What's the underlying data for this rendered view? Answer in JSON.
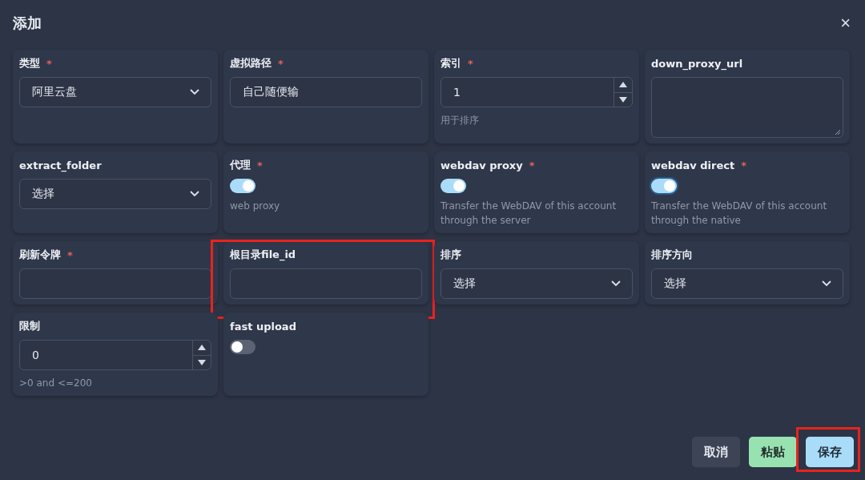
{
  "dialog": {
    "title": "添加",
    "close": "×"
  },
  "fields": [
    {
      "kind": "select",
      "label": "类型",
      "required_mark": "*",
      "value": "阿里云盘"
    },
    {
      "kind": "text",
      "label": "虚拟路径",
      "required_mark": "*",
      "value": "自己随便输"
    },
    {
      "kind": "number",
      "label": "索引",
      "required_mark": "*",
      "value": "1",
      "hint": "用于排序"
    },
    {
      "kind": "textarea",
      "label": "down_proxy_url"
    },
    {
      "kind": "select",
      "label": "extract_folder",
      "value": "选择"
    },
    {
      "kind": "switch",
      "label": "代理",
      "required_mark": "*",
      "on": true,
      "focused": false,
      "hint": "web proxy"
    },
    {
      "kind": "switch",
      "label": "webdav proxy",
      "required_mark": "*",
      "on": true,
      "focused": false,
      "hint": "Transfer the WebDAV of this account through the server"
    },
    {
      "kind": "switch",
      "label": "webdav direct",
      "required_mark": "*",
      "on": true,
      "focused": true,
      "hint": "Transfer the WebDAV of this account through the native"
    },
    {
      "kind": "text",
      "label": "刷新令牌",
      "required_mark": "*"
    },
    {
      "kind": "text",
      "label": "根目录file_id",
      "highlighted": true
    },
    {
      "kind": "select",
      "label": "排序",
      "value": "选择"
    },
    {
      "kind": "select",
      "label": "排序方向",
      "value": "选择"
    },
    {
      "kind": "number",
      "label": "限制",
      "value": "0",
      "hint": ">0 and <=200"
    },
    {
      "kind": "switch",
      "label": "fast upload",
      "on": false,
      "focused": false
    }
  ],
  "buttons": [
    {
      "kind": "neutral",
      "label": "取消",
      "highlighted": false
    },
    {
      "kind": "success",
      "label": "粘贴",
      "highlighted": false
    },
    {
      "kind": "primary",
      "label": "保存",
      "highlighted": true
    }
  ]
}
